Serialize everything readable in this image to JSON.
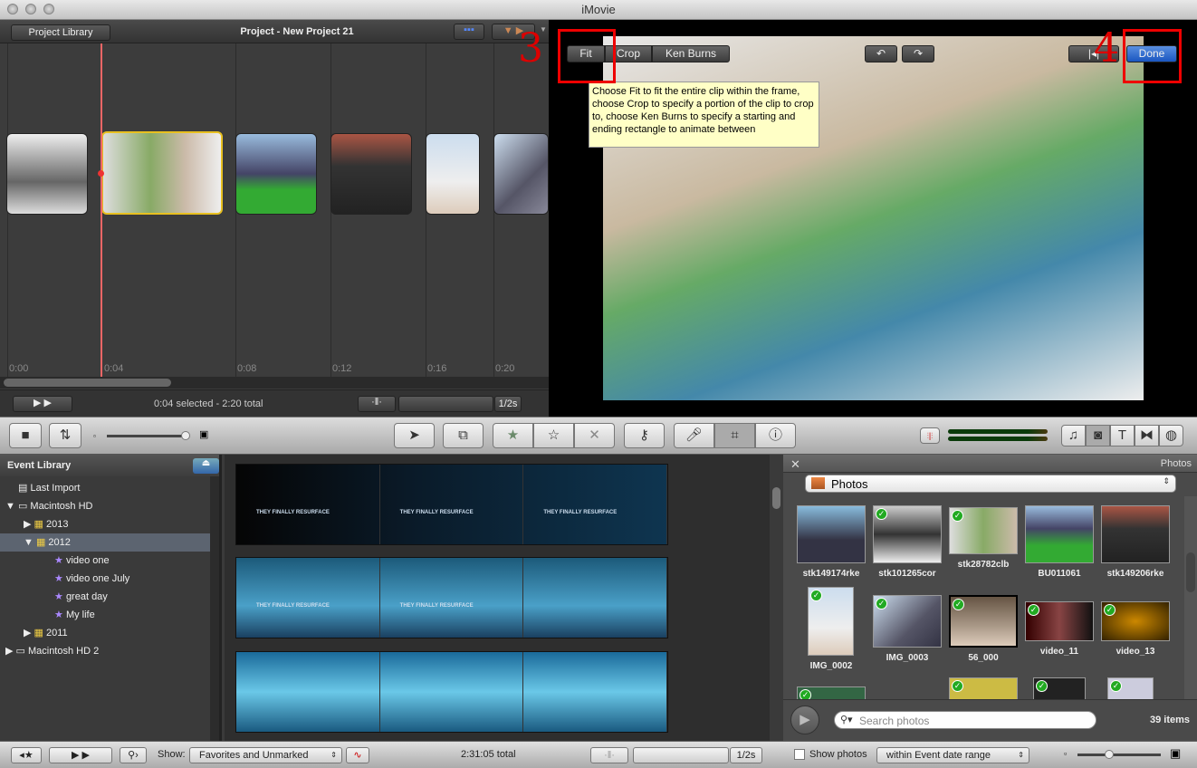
{
  "app": {
    "title": "iMovie"
  },
  "project": {
    "back_label": "Project Library",
    "title": "Project - New Project 21",
    "status": "0:04 selected - 2:20 total",
    "zoom_value": "1/2s",
    "time_labels": [
      "0:00",
      "0:04",
      "0:08",
      "0:12",
      "0:16",
      "0:20"
    ]
  },
  "viewer": {
    "fit_label": "Fit",
    "crop_label": "Crop",
    "ken_burns_label": "Ken Burns",
    "done_label": "Done",
    "tooltip": "Choose Fit to fit the entire clip within the frame, choose Crop to specify a portion of the clip to crop to, choose Ken Burns to specify a starting and ending rectangle to animate between",
    "annotation_3": "3",
    "annotation_4": "4",
    "annotation_color": "#e00000"
  },
  "event_library": {
    "title": "Event Library",
    "items": [
      {
        "label": "Last Import"
      },
      {
        "label": "Macintosh HD"
      },
      {
        "label": "2013"
      },
      {
        "label": "2012"
      },
      {
        "label": "video one"
      },
      {
        "label": "video one July"
      },
      {
        "label": "great day"
      },
      {
        "label": "My life"
      },
      {
        "label": "2011"
      },
      {
        "label": "Macintosh HD 2"
      }
    ]
  },
  "browser": {
    "caption": "THEY FINALLY RESURFACE"
  },
  "photos": {
    "header": "Photos",
    "source": "Photos",
    "search_placeholder": "Search photos",
    "count": "39 items",
    "items": [
      {
        "name": "stk149174rke"
      },
      {
        "name": "stk101265cor"
      },
      {
        "name": "stk28782clb"
      },
      {
        "name": "BU011061"
      },
      {
        "name": "stk149206rke"
      },
      {
        "name": "IMG_0002"
      },
      {
        "name": "IMG_0003"
      },
      {
        "name": "56_000"
      },
      {
        "name": "video_11"
      },
      {
        "name": "video_13"
      }
    ]
  },
  "bottom": {
    "show_label": "Show:",
    "show_value": "Favorites and Unmarked",
    "total": "2:31:05 total",
    "zoom_value": "1/2s",
    "show_photos_label": "Show photos",
    "date_range": "within Event date range"
  }
}
